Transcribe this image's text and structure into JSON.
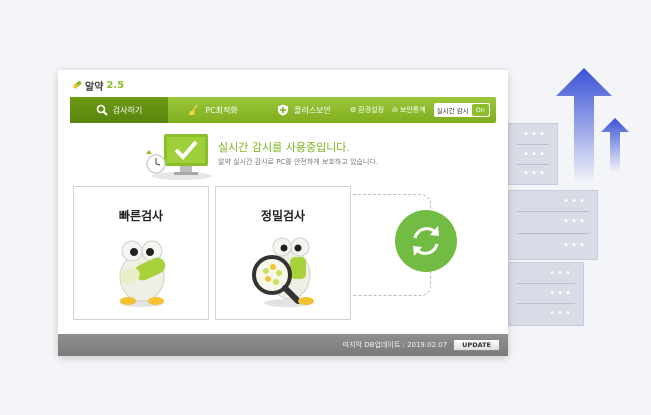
{
  "app": {
    "name": "알약",
    "version": "2.5"
  },
  "nav": {
    "tabs": [
      {
        "label": "검사하기",
        "icon": "magnifier-icon"
      },
      {
        "label": "PC최적화",
        "icon": "broom-icon"
      },
      {
        "label": "플러스보안",
        "icon": "shield-plus-icon"
      }
    ],
    "settings_label": "환경설정",
    "stats_label": "보안통계",
    "realtime_label": "실시간 감시",
    "realtime_state": "On"
  },
  "status": {
    "title": "실시간 감시를 사용중입니다.",
    "subtitle": "알약 실시간 감시로 PC를 안전하게 보호하고 있습니다."
  },
  "cards": {
    "quick_label": "빠른검사",
    "precise_label": "정밀검사"
  },
  "footer": {
    "update_text": "마지막 DB업데이트 : 2019.02.07",
    "update_button": "UPDATE"
  },
  "colors": {
    "brand_green": "#8bbf2a",
    "refresh_green": "#72bc44",
    "arrow_blue": "#3f57d8"
  }
}
